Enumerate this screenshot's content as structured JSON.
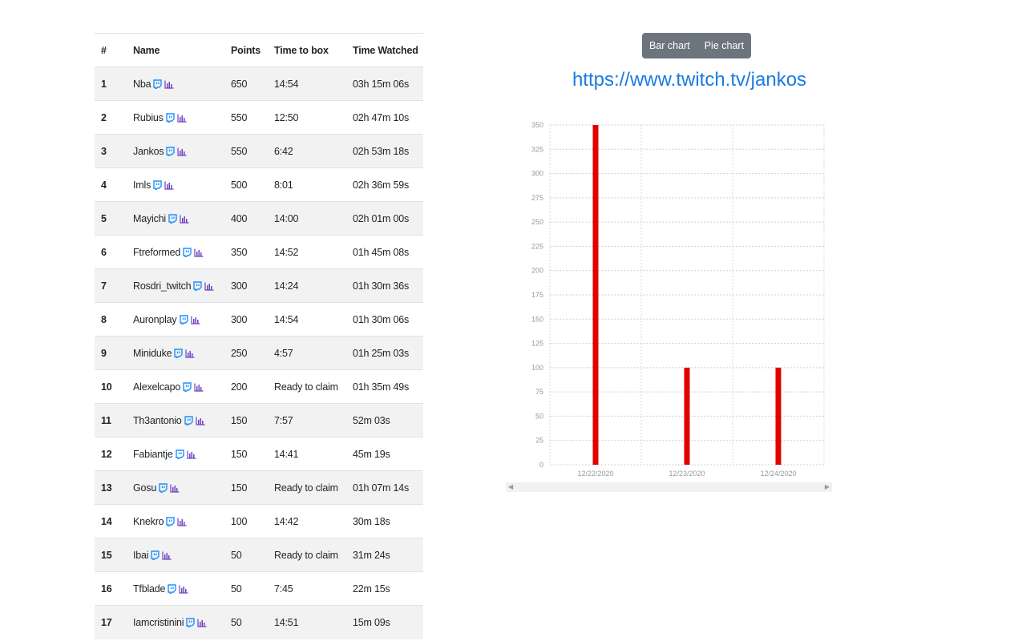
{
  "table": {
    "headers": {
      "rank": "#",
      "name": "Name",
      "points": "Points",
      "time_to_box": "Time to box",
      "time_watched": "Time Watched"
    },
    "rows": [
      {
        "rank": "1",
        "name": "Nba",
        "points": "650",
        "time_to_box": "14:54",
        "time_watched": "03h 15m 06s"
      },
      {
        "rank": "2",
        "name": "Rubius",
        "points": "550",
        "time_to_box": "12:50",
        "time_watched": "02h 47m 10s"
      },
      {
        "rank": "3",
        "name": "Jankos",
        "points": "550",
        "time_to_box": "6:42",
        "time_watched": "02h 53m 18s"
      },
      {
        "rank": "4",
        "name": "Imls",
        "points": "500",
        "time_to_box": "8:01",
        "time_watched": "02h 36m 59s"
      },
      {
        "rank": "5",
        "name": "Mayichi",
        "points": "400",
        "time_to_box": "14:00",
        "time_watched": "02h 01m 00s"
      },
      {
        "rank": "6",
        "name": "Ftreformed",
        "points": "350",
        "time_to_box": "14:52",
        "time_watched": "01h 45m 08s"
      },
      {
        "rank": "7",
        "name": "Rosdri_twitch",
        "points": "300",
        "time_to_box": "14:24",
        "time_watched": "01h 30m 36s"
      },
      {
        "rank": "8",
        "name": "Auronplay",
        "points": "300",
        "time_to_box": "14:54",
        "time_watched": "01h 30m 06s"
      },
      {
        "rank": "9",
        "name": "Miniduke",
        "points": "250",
        "time_to_box": "4:57",
        "time_watched": "01h 25m 03s"
      },
      {
        "rank": "10",
        "name": "Alexelcapo",
        "points": "200",
        "time_to_box": "Ready to claim",
        "time_watched": "01h 35m 49s"
      },
      {
        "rank": "11",
        "name": "Th3antonio",
        "points": "150",
        "time_to_box": "7:57",
        "time_watched": "52m 03s"
      },
      {
        "rank": "12",
        "name": "Fabiantje",
        "points": "150",
        "time_to_box": "14:41",
        "time_watched": "45m 19s"
      },
      {
        "rank": "13",
        "name": "Gosu",
        "points": "150",
        "time_to_box": "Ready to claim",
        "time_watched": "01h 07m 14s"
      },
      {
        "rank": "14",
        "name": "Knekro",
        "points": "100",
        "time_to_box": "14:42",
        "time_watched": "30m 18s"
      },
      {
        "rank": "15",
        "name": "Ibai",
        "points": "50",
        "time_to_box": "Ready to claim",
        "time_watched": "31m 24s"
      },
      {
        "rank": "16",
        "name": "Tfblade",
        "points": "50",
        "time_to_box": "7:45",
        "time_watched": "22m 15s"
      },
      {
        "rank": "17",
        "name": "Iamcristinini",
        "points": "50",
        "time_to_box": "14:51",
        "time_watched": "15m 09s"
      }
    ],
    "icons": {
      "twitch": "twitch-icon",
      "stats": "bar-chart-icon"
    }
  },
  "chart_panel": {
    "buttons": {
      "bar": "Bar chart",
      "pie": "Pie chart"
    },
    "channel_url": "https://www.twitch.tv/jankos"
  },
  "colors": {
    "twitch": "#1e90ff",
    "stats": "#6f42c1",
    "bar": "#e00000",
    "link": "#1a7be3",
    "button_bg": "#6c757d"
  },
  "chart_data": {
    "type": "bar",
    "categories": [
      "12/22/2020",
      "12/23/2020",
      "12/24/2020"
    ],
    "values": [
      350,
      100,
      100
    ],
    "ylim": [
      0,
      350
    ],
    "yticks": [
      0,
      25,
      50,
      75,
      100,
      125,
      150,
      175,
      200,
      225,
      250,
      275,
      300,
      325,
      350
    ],
    "grid": true,
    "title": "",
    "xlabel": "",
    "ylabel": ""
  }
}
